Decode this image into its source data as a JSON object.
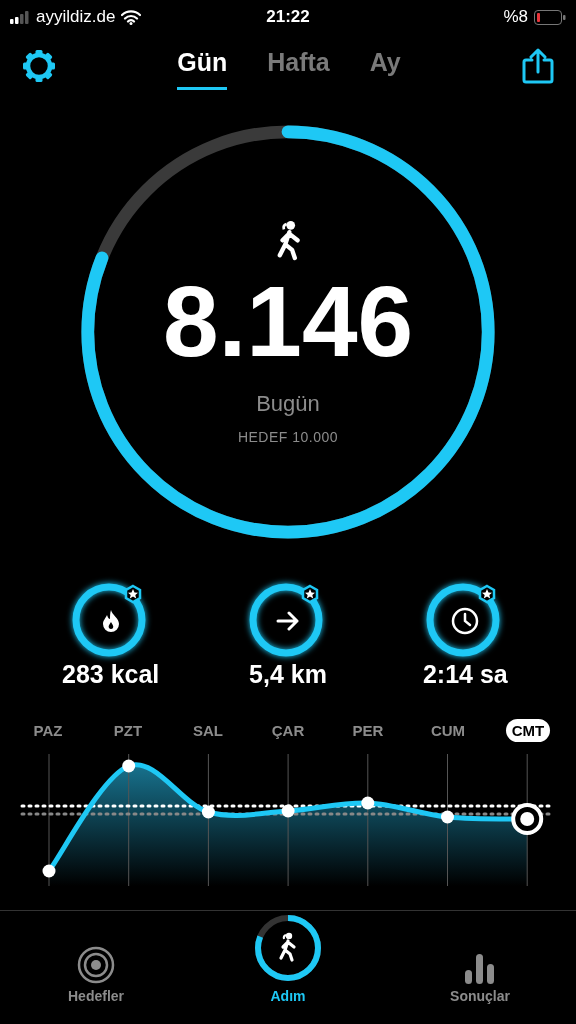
{
  "status_bar": {
    "carrier": "ayyildiz.de",
    "time": "21:22",
    "battery": "%8"
  },
  "tabs": [
    {
      "label": "Gün",
      "selected": true
    },
    {
      "label": "Hafta",
      "selected": false
    },
    {
      "label": "Ay",
      "selected": false
    }
  ],
  "progress": {
    "level": 0.81,
    "steps": "8.146",
    "period": "Bugün",
    "goal": "HEDEF 10.000"
  },
  "stats": [
    {
      "kind": "flame",
      "value": "283 kcal"
    },
    {
      "kind": "arrow",
      "value": "5,4 km"
    },
    {
      "kind": "clock",
      "value": "2:14 sa"
    }
  ],
  "days": [
    {
      "label": "PAZ",
      "selected": false
    },
    {
      "label": "PZT",
      "selected": false
    },
    {
      "label": "SAL",
      "selected": false
    },
    {
      "label": "ÇAR",
      "selected": false
    },
    {
      "label": "PER",
      "selected": false
    },
    {
      "label": "CUM",
      "selected": false
    },
    {
      "label": "CMT",
      "selected": true
    }
  ],
  "tab_bar": [
    {
      "kind": "target",
      "label": "Hedefler",
      "selected": false
    },
    {
      "kind": "walk",
      "label": "Adım",
      "selected": true
    },
    {
      "kind": "bars",
      "label": "Sonuçlar",
      "selected": false
    }
  ]
}
